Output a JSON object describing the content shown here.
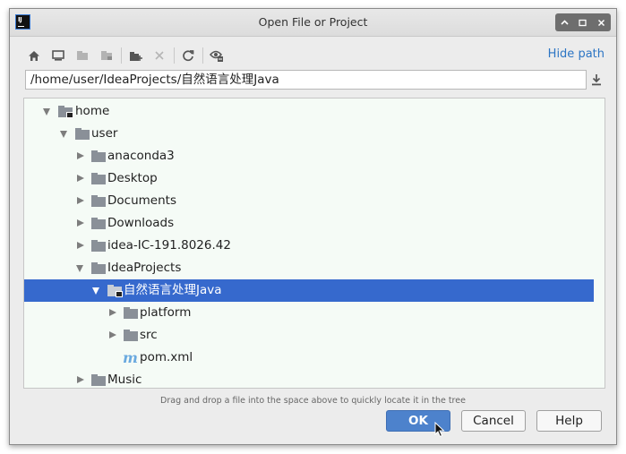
{
  "window": {
    "title": "Open File or Project"
  },
  "app_logo": {
    "text": "IJ"
  },
  "toolbar": {
    "icons": [
      "home-icon",
      "desktop-icon",
      "project-icon",
      "module-icon",
      "new-folder-icon",
      "delete-icon",
      "refresh-icon",
      "show-hidden-icon"
    ],
    "hide_path_label": "Hide path"
  },
  "path": {
    "value": "/home/user/IdeaProjects/自然语言处理Java"
  },
  "tree": {
    "items": [
      {
        "label": "home",
        "expanded": true,
        "type": "folder"
      },
      {
        "label": "user",
        "expanded": true,
        "type": "folder"
      },
      {
        "label": "anaconda3",
        "expanded": false,
        "type": "folder"
      },
      {
        "label": "Desktop",
        "expanded": false,
        "type": "folder"
      },
      {
        "label": "Documents",
        "expanded": false,
        "type": "folder"
      },
      {
        "label": "Downloads",
        "expanded": false,
        "type": "folder"
      },
      {
        "label": "idea-IC-191.8026.42",
        "expanded": false,
        "type": "folder"
      },
      {
        "label": "IdeaProjects",
        "expanded": true,
        "type": "folder"
      },
      {
        "label": "自然语言处理Java",
        "expanded": true,
        "type": "project-folder",
        "selected": true
      },
      {
        "label": "platform",
        "expanded": false,
        "type": "folder"
      },
      {
        "label": "src",
        "expanded": false,
        "type": "folder"
      },
      {
        "label": "pom.xml",
        "type": "maven-file",
        "icon_text": "m"
      },
      {
        "label": "Music",
        "expanded": false,
        "type": "folder"
      }
    ]
  },
  "hint": "Drag and drop a file into the space above to quickly locate it in the tree",
  "buttons": {
    "ok": "OK",
    "cancel": "Cancel",
    "help": "Help"
  },
  "colors": {
    "selection": "#3669cd",
    "link": "#2c75c4",
    "ok_button": "#4d82cc",
    "tree_bg": "#f5fbf6"
  }
}
